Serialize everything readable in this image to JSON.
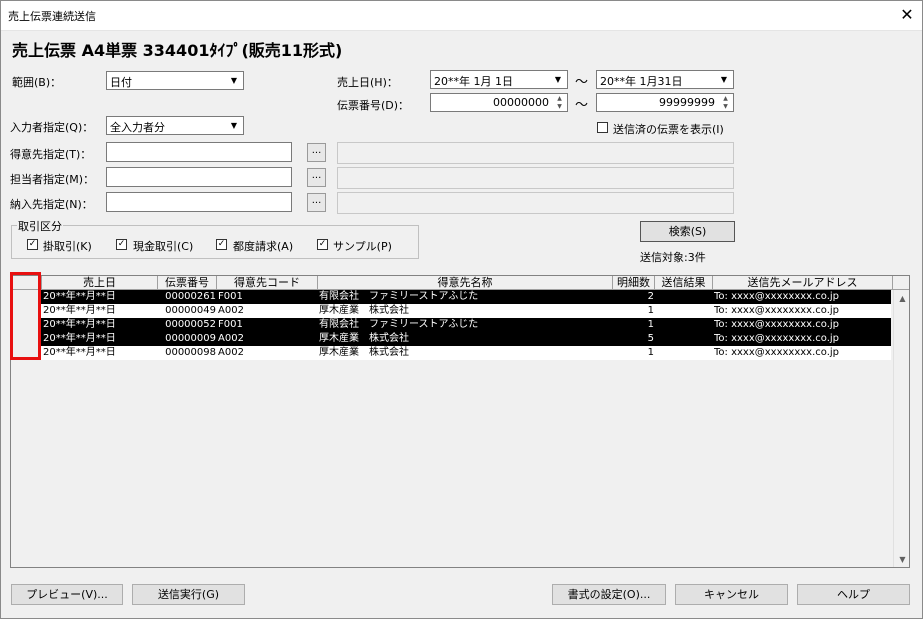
{
  "window": {
    "title": "売上伝票連続送信",
    "close_glyph": "✕"
  },
  "heading": "売上伝票 A4単票 334401ﾀｲﾌﾟ(販売11形式)",
  "range": {
    "label": "範囲(B)：",
    "value": "日付"
  },
  "sales_date": {
    "label": "売上日(H)：",
    "from": "20**年  1月  1日",
    "to": "20**年  1月31日",
    "tilde": "〜"
  },
  "slip_no": {
    "label": "伝票番号(D)：",
    "from": "00000000",
    "to": "99999999",
    "tilde": "〜"
  },
  "operator": {
    "label": "入力者指定(Q)：",
    "value": "全入力者分"
  },
  "show_sent": {
    "label": "送信済の伝票を表示(I)",
    "checked": false
  },
  "customer": {
    "label": "得意先指定(T)：",
    "value": ""
  },
  "staff": {
    "label": "担当者指定(M)：",
    "value": ""
  },
  "delivery": {
    "label": "納入先指定(N)：",
    "value": ""
  },
  "dots_label": "...",
  "txn": {
    "legend": "取引区分",
    "items": [
      {
        "label": "掛取引(K)",
        "checked": true
      },
      {
        "label": "現金取引(C)",
        "checked": true
      },
      {
        "label": "都度請求(A)",
        "checked": true
      },
      {
        "label": "サンプル(P)",
        "checked": true
      }
    ]
  },
  "search_button": "検索(S)",
  "send_count": "送信対象:3件",
  "table": {
    "columns": [
      "売上日",
      "伝票番号",
      "得意先コード",
      "得意先名称",
      "明細数",
      "送信結果",
      "送信先メールアドレス"
    ],
    "rows": [
      {
        "date": "20**年**月**日",
        "no": "00000261",
        "code": "F001",
        "name": "有限会社　ファミリーストアふじた",
        "count": "2",
        "result": "",
        "mail": "To: xxxx@xxxxxxxx.co.jp",
        "selected": true
      },
      {
        "date": "20**年**月**日",
        "no": "00000049",
        "code": "A002",
        "name": "厚木産業　株式会社",
        "count": "1",
        "result": "",
        "mail": "To: xxxx@xxxxxxxx.co.jp",
        "selected": false
      },
      {
        "date": "20**年**月**日",
        "no": "00000052",
        "code": "F001",
        "name": "有限会社　ファミリーストアふじた",
        "count": "1",
        "result": "",
        "mail": "To: xxxx@xxxxxxxx.co.jp",
        "selected": true
      },
      {
        "date": "20**年**月**日",
        "no": "00000009",
        "code": "A002",
        "name": "厚木産業　株式会社",
        "count": "5",
        "result": "",
        "mail": "To: xxxx@xxxxxxxx.co.jp",
        "selected": true
      },
      {
        "date": "20**年**月**日",
        "no": "00000098",
        "code": "A002",
        "name": "厚木産業　株式会社",
        "count": "1",
        "result": "",
        "mail": "To: xxxx@xxxxxxxx.co.jp",
        "selected": false
      }
    ]
  },
  "buttons": {
    "preview": "プレビュー(V)...",
    "send": "送信実行(G)",
    "format": "書式の設定(O)...",
    "cancel": "キャンセル",
    "help": "ヘルプ"
  },
  "colors": {
    "selected_row": "#000000",
    "highlight_box": "#e81010"
  }
}
